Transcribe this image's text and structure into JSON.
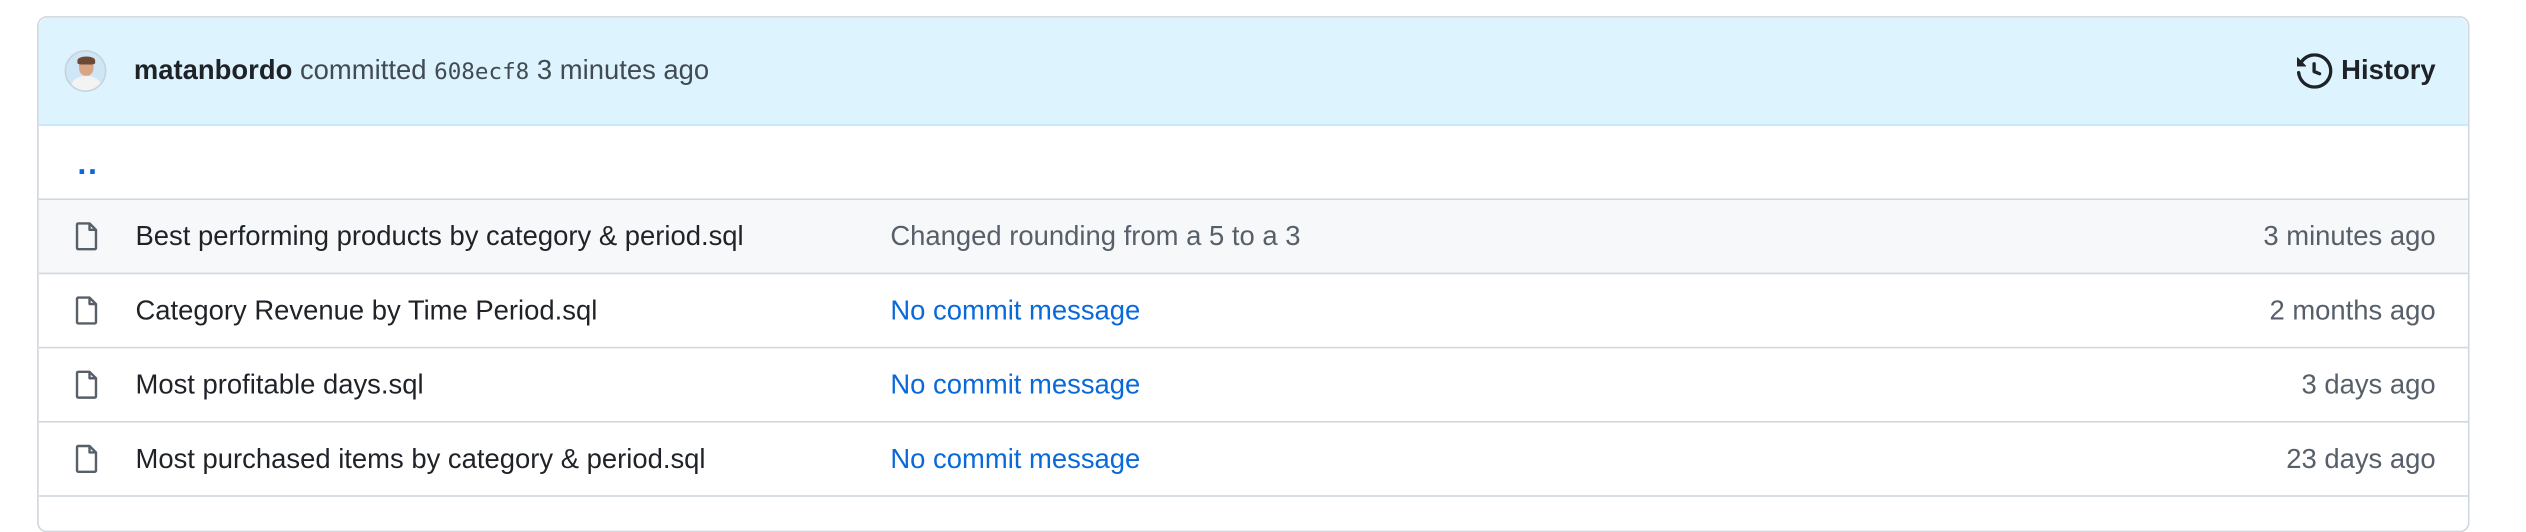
{
  "commit_bar": {
    "author": "matanbordo",
    "verb": "committed",
    "sha": "608ecf8",
    "time": "3 minutes ago",
    "history_label": "History"
  },
  "parent_link": "..",
  "files": [
    {
      "name": "Best performing products by category & period.sql",
      "message": "Changed rounding from a 5 to a 3",
      "message_is_link": false,
      "age": "3 minutes ago",
      "highlighted": true
    },
    {
      "name": "Category Revenue by Time Period.sql",
      "message": "No commit message",
      "message_is_link": true,
      "age": "2 months ago",
      "highlighted": false
    },
    {
      "name": "Most profitable days.sql",
      "message": "No commit message",
      "message_is_link": true,
      "age": "3 days ago",
      "highlighted": false
    },
    {
      "name": "Most purchased items by category & period.sql",
      "message": "No commit message",
      "message_is_link": true,
      "age": "23 days ago",
      "highlighted": false
    }
  ],
  "colors": {
    "accent_link": "#0969da",
    "commit_bar_bg": "#ddf4ff",
    "row_highlight_bg": "#f6f8fa",
    "border": "#d0d7de"
  },
  "icons": {
    "avatar": "user-avatar",
    "history": "history-clock-icon",
    "file": "file-icon"
  }
}
